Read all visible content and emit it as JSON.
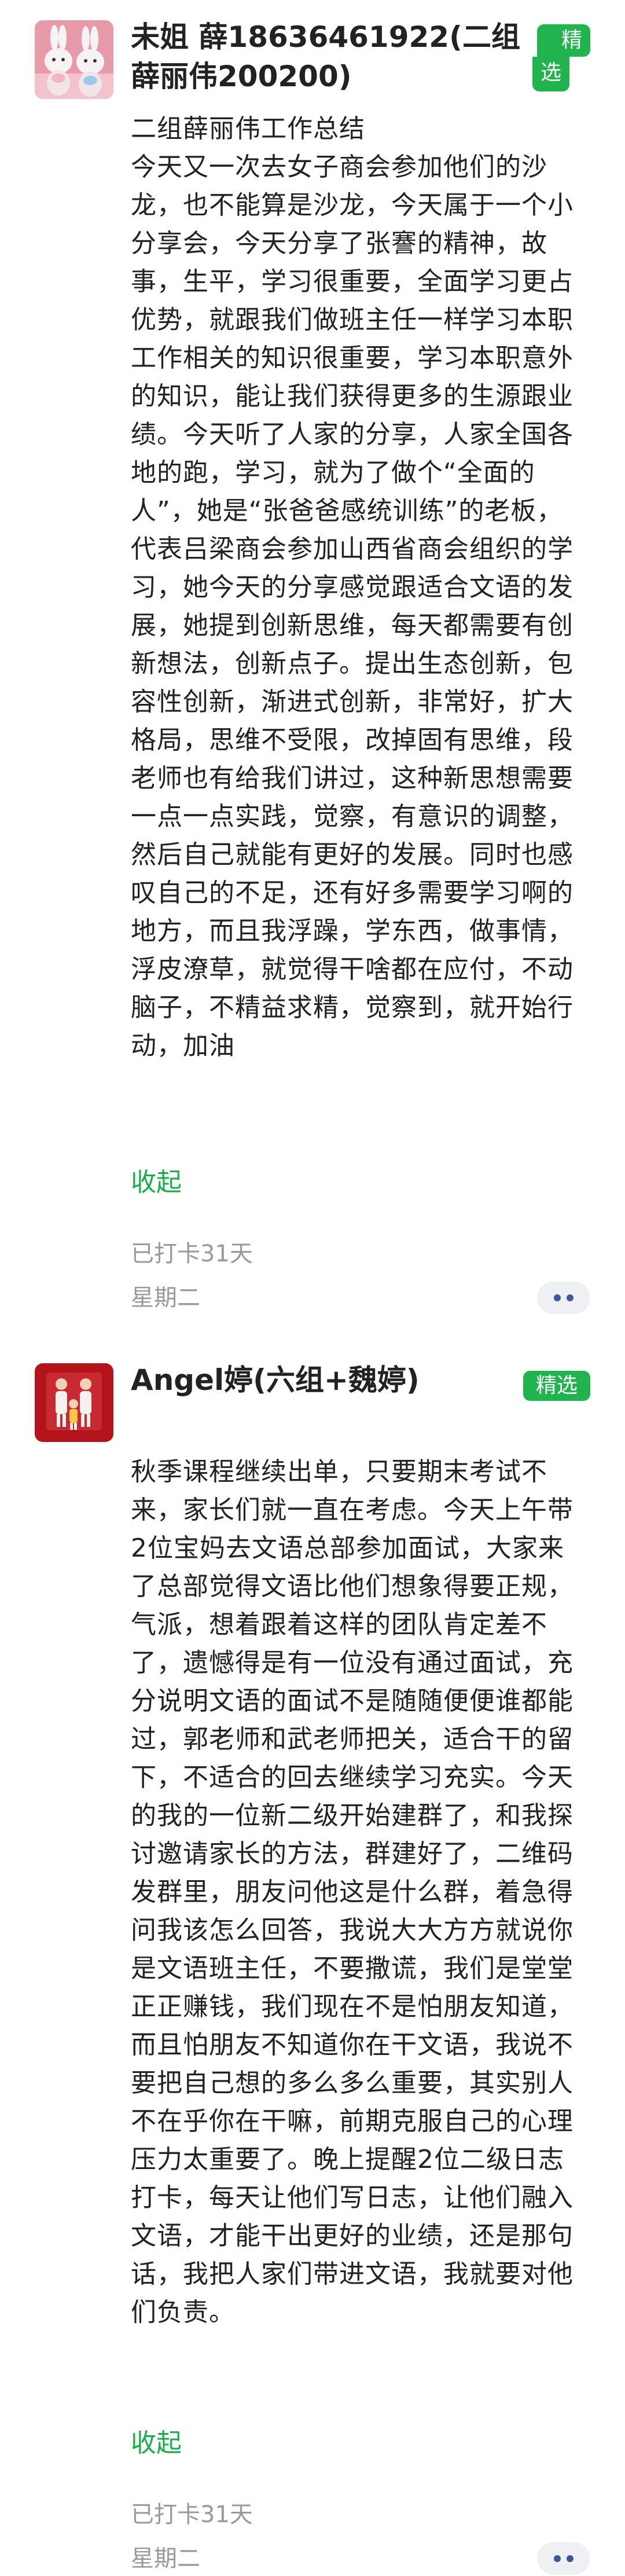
{
  "posts": [
    {
      "author": "未姐 薛18636461922(二组薛丽伟200200)",
      "badge_line1": "精",
      "badge_line2": "选",
      "content": "二组薛丽伟工作总结\n今天又一次去女子商会参加他们的沙龙，也不能算是沙龙，今天属于一个小分享会，今天分享了张謇的精神，故事，生平，学习很重要，全面学习更占优势，就跟我们做班主任一样学习本职工作相关的知识很重要，学习本职意外的知识，能让我们获得更多的生源跟业绩。今天听了人家的分享，人家全国各地的跑，学习，就为了做个“全面的人”，她是“张爸爸感统训练”的老板，代表吕梁商会参加山西省商会组织的学习，她今天的分享感觉跟适合文语的发展，她提到创新思维，每天都需要有创新想法，创新点子。提出生态创新，包容性创新，渐进式创新，非常好，扩大格局，思维不受限，改掉固有思维，段老师也有给我们讲过，这种新思想需要一点一点实践，觉察，有意识的调整，然后自己就能有更好的发展。同时也感叹自己的不足，还有好多需要学习啊的地方，而且我浮躁，学东西，做事情，浮皮潦草，就觉得干啥都在应付，不动脑子，不精益求精，觉察到，就开始行动，加油",
      "collapse": "收起",
      "checkin": "已打卡31天",
      "weekday": "星期二"
    },
    {
      "author": "Angel婷(六组+魏婷)",
      "badge": "精选",
      "content": "秋季课程继续出单，只要期末考试不来，家长们就一直在考虑。今天上午带2位宝妈去文语总部参加面试，大家来了总部觉得文语比他们想象得要正规，气派，想着跟着这样的团队肯定差不了，遗憾得是有一位没有通过面试，充分说明文语的面试不是随随便便谁都能过，郭老师和武老师把关，适合干的留下，不适合的回去继续学习充实。今天的我的一位新二级开始建群了，和我探讨邀请家长的方法，群建好了，二维码发群里，朋友问他这是什么群，着急得问我该怎么回答，我说大大方方就说你是文语班主任，不要撒谎，我们是堂堂正正赚钱，我们现在不是怕朋友知道，而且怕朋友不知道你在干文语，我说不要把自己想的多么多么重要，其实别人不在乎你在干嘛，前期克服自己的心理压力太重要了。晚上提醒2位二级日志打卡，每天让他们写日志，让他们融入文语，才能干出更好的业绩，还是那句话，我把人家们带进文语，我就要对他们负责。",
      "collapse": "收起",
      "checkin": "已打卡31天",
      "weekday": "星期二"
    }
  ],
  "colors": {
    "accent_green": "#21b34d",
    "link_green": "#1aad4b",
    "meta_gray": "#9a9a9a",
    "more_button_bg": "#eef0f4",
    "more_button_dot": "#3b5a9a"
  }
}
